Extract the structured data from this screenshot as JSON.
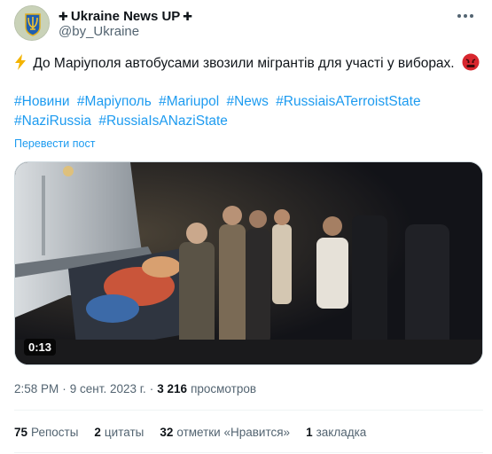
{
  "account": {
    "display_name": "Ukraine News UP",
    "name_symbol": "✚",
    "handle": "@by_Ukraine",
    "avatar_icon": "ukraine-trident-icon"
  },
  "tweet": {
    "text": "До Маріуполя автобусами звозили мігрантів для участі у виборах.",
    "lead_icon": "lightning-icon",
    "trail_icon": "angry-face-icon",
    "hashtags": [
      "#Новини",
      "#Маріуполь",
      "#Mariupol",
      "#News",
      "#RussiaisATerroistState",
      "#NaziRussia",
      "#RussiaIsANaziState"
    ],
    "translate_label": "Перевести пост"
  },
  "video": {
    "duration": "0:13"
  },
  "meta": {
    "time": "2:58 PM",
    "separator": "·",
    "date": "9 сент. 2023 г.",
    "views_count": "3 216",
    "views_label": "просмотров"
  },
  "stats": {
    "reposts_count": "75",
    "reposts_label": "Репосты",
    "quotes_count": "2",
    "quotes_label": "цитаты",
    "likes_count": "32",
    "likes_label": "отметки «Нравится»",
    "bookmarks_count": "1",
    "bookmarks_label": "закладка"
  },
  "colors": {
    "link": "#1d9bf0",
    "secondary_text": "#536471",
    "primary_text": "#0f1419"
  }
}
